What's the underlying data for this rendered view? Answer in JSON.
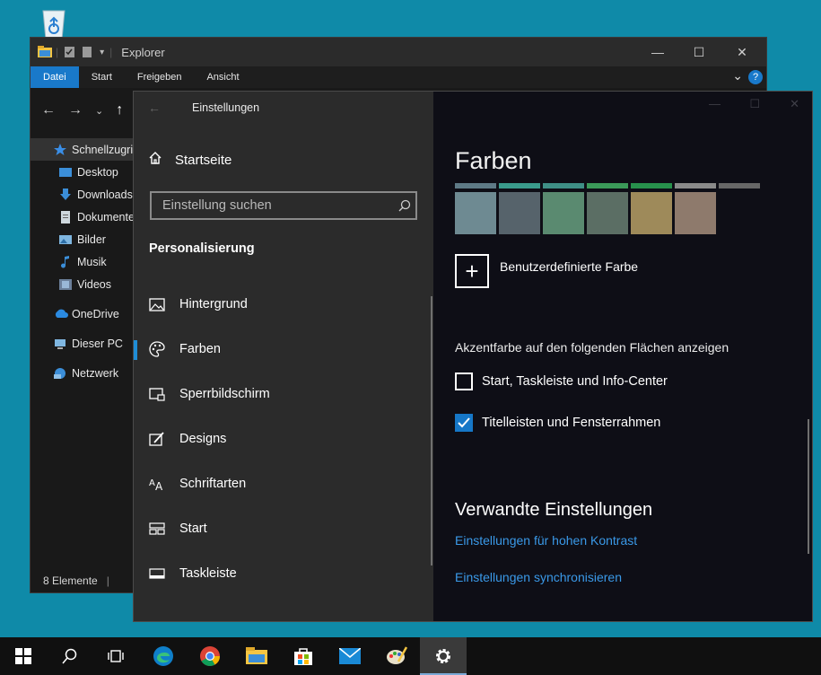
{
  "explorer": {
    "title": "Explorer",
    "ribbon_tabs": [
      "Datei",
      "Start",
      "Freigeben",
      "Ansicht"
    ],
    "sidebar": [
      {
        "label": "Schnellzugriff",
        "icon": "star-icon"
      },
      {
        "label": "Desktop",
        "icon": "desktop-folder-icon"
      },
      {
        "label": "Downloads",
        "icon": "download-icon"
      },
      {
        "label": "Dokumente",
        "icon": "document-icon"
      },
      {
        "label": "Bilder",
        "icon": "pictures-icon"
      },
      {
        "label": "Musik",
        "icon": "music-icon"
      },
      {
        "label": "Videos",
        "icon": "video-icon"
      },
      {
        "label": "OneDrive",
        "icon": "cloud-icon"
      },
      {
        "label": "Dieser PC",
        "icon": "computer-icon"
      },
      {
        "label": "Netzwerk",
        "icon": "network-icon"
      }
    ],
    "status": "8 Elemente"
  },
  "settings": {
    "title": "Einstellungen",
    "home": "Startseite",
    "search_placeholder": "Einstellung suchen",
    "section": "Personalisierung",
    "nav": [
      {
        "label": "Hintergrund",
        "icon": "image-icon"
      },
      {
        "label": "Farben",
        "icon": "palette-icon"
      },
      {
        "label": "Sperrbildschirm",
        "icon": "lock-screen-icon"
      },
      {
        "label": "Designs",
        "icon": "brush-icon"
      },
      {
        "label": "Schriftarten",
        "icon": "font-icon"
      },
      {
        "label": "Start",
        "icon": "start-layout-icon"
      },
      {
        "label": "Taskleiste",
        "icon": "taskbar-icon"
      }
    ],
    "page_title": "Farben",
    "swatch_strips": [
      "#5e7a86",
      "#3a9b8c",
      "#3f8f86",
      "#3b9a59",
      "#27914c",
      "#8a8a8a",
      "#676767"
    ],
    "swatch_blocks": [
      "#6e8a92",
      "#56636b",
      "#5a8a70",
      "#5b6e64",
      "#9e8a5a",
      "#8e7a6c"
    ],
    "custom_color": "Benutzerdefinierte Farbe",
    "accent_heading": "Akzentfarbe auf den folgenden Flächen anzeigen",
    "checkbox_start": "Start, Taskleiste und Info-Center",
    "checkbox_start_checked": false,
    "checkbox_title": "Titelleisten und Fensterrahmen",
    "checkbox_title_checked": true,
    "related_heading": "Verwandte Einstellungen",
    "link_contrast": "Einstellungen für hohen Kontrast",
    "link_sync": "Einstellungen synchronisieren"
  },
  "taskbar": {
    "items": [
      "windows-start-icon",
      "search-icon",
      "task-view-icon",
      "edge-icon",
      "chrome-icon",
      "file-explorer-icon",
      "store-icon",
      "mail-icon",
      "paint-icon",
      "settings-gear-icon"
    ],
    "active": "settings-gear-icon"
  }
}
